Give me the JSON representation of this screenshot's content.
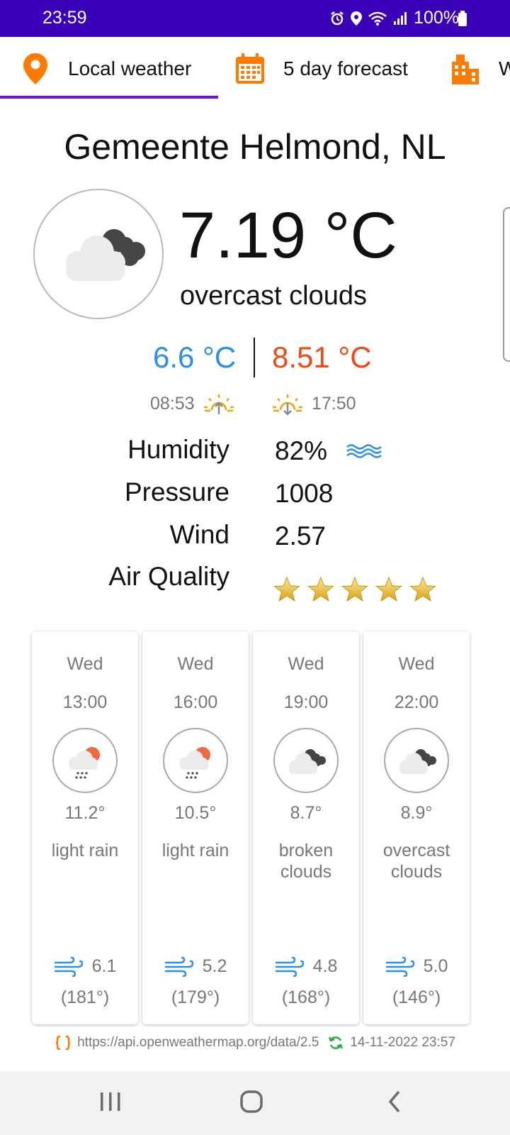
{
  "status_bar": {
    "time": "23:59",
    "battery": "100%",
    "icons": [
      "alarm-icon",
      "location-icon",
      "wifi-icon",
      "signal-icon",
      "battery-icon"
    ],
    "background": "#3a00b8"
  },
  "tabs": {
    "items": [
      {
        "label": "Local weather",
        "icon": "location-pin-icon"
      },
      {
        "label": "5 day forecast",
        "icon": "calendar-icon"
      },
      {
        "label": "W",
        "icon": "city-icon"
      }
    ],
    "active_index": 0,
    "accent": "#6a13e6",
    "icon_color": "#ff7a00"
  },
  "current": {
    "city": "Gemeente Helmond, NL",
    "icon": "overcast-clouds-icon",
    "temperature": "7.19 °C",
    "description": "overcast clouds",
    "min_temp": "6.6 °C",
    "max_temp": "8.51 °C",
    "min_color": "#2a8fe8",
    "max_color": "#f04a14",
    "sunrise": "08:53",
    "sunset": "17:50"
  },
  "details": {
    "humidity_label": "Humidity",
    "humidity_value": "82%",
    "pressure_label": "Pressure",
    "pressure_value": "1008",
    "wind_label": "Wind",
    "wind_value": "2.57",
    "air_quality_label": "Air Quality",
    "air_quality_stars": 5
  },
  "hourly": [
    {
      "day": "Wed",
      "time": "13:00",
      "icon": "light-rain-icon",
      "temp": "11.2°",
      "desc": "light rain",
      "wind": "6.1",
      "deg": "(181°)"
    },
    {
      "day": "Wed",
      "time": "16:00",
      "icon": "light-rain-icon",
      "temp": "10.5°",
      "desc": "light rain",
      "wind": "5.2",
      "deg": "(179°)"
    },
    {
      "day": "Wed",
      "time": "19:00",
      "icon": "broken-clouds-icon",
      "temp": "8.7°",
      "desc": "broken clouds",
      "wind": "4.8",
      "deg": "(168°)"
    },
    {
      "day": "Wed",
      "time": "22:00",
      "icon": "overcast-clouds-icon",
      "temp": "8.9°",
      "desc": "overcast clouds",
      "wind": "5.0",
      "deg": "(146°)"
    }
  ],
  "footer": {
    "url": "https://api.openweathermap.org/data/2.5",
    "timestamp": "14-11-2022 23:57"
  }
}
